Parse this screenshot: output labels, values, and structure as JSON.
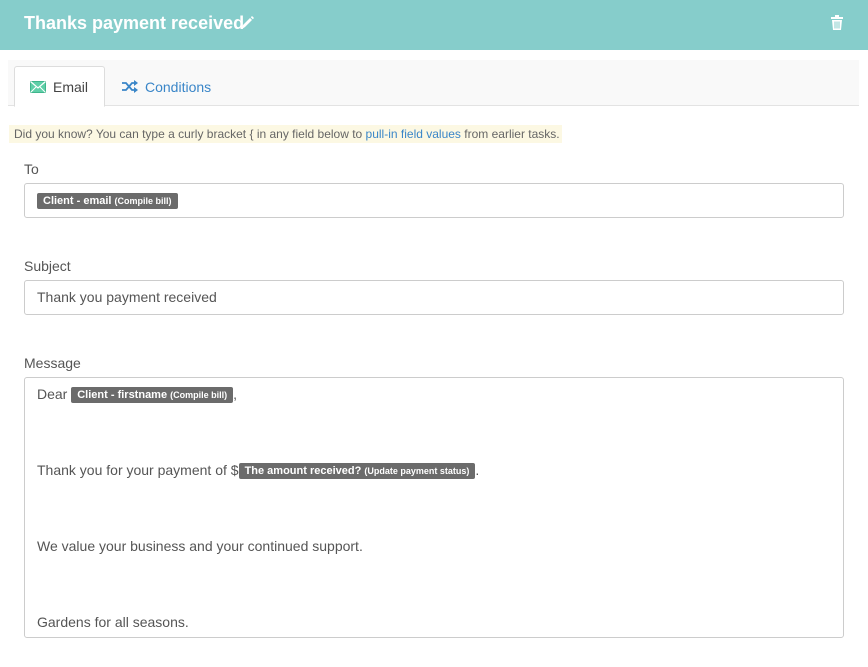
{
  "header": {
    "title": "Thanks payment received",
    "edit_icon": "pencil-icon",
    "delete_icon": "trash-icon",
    "background": "#86cdcb"
  },
  "tabs": [
    {
      "label": "Email",
      "icon": "envelope-icon",
      "active": true
    },
    {
      "label": "Conditions",
      "icon": "shuffle-icon",
      "active": false
    }
  ],
  "tip": {
    "prefix": "Did you know? You can type a curly bracket { in any field below to ",
    "link": "pull-in field values",
    "suffix": " from earlier tasks."
  },
  "fields": {
    "to": {
      "label": "To",
      "tokens": [
        {
          "name": "Client - email",
          "source": "(Compile bill)"
        }
      ]
    },
    "subject": {
      "label": "Subject",
      "value": "Thank you payment received"
    },
    "message": {
      "label": "Message",
      "line1": {
        "text": "Dear ",
        "token_name": "Client - firstname",
        "token_source": "(Compile bill)",
        "after": ","
      },
      "line2": {
        "text": "Thank you for your payment of $",
        "token_name": "The amount received?",
        "token_source": "(Update payment status)",
        "after": "."
      },
      "line3": {
        "text": "We value your business and your continued support."
      },
      "line4": {
        "text": "Gardens for all seasons."
      }
    }
  },
  "colors": {
    "link": "#3a86c8",
    "token_bg": "#6b6b6b",
    "tip_bg": "#fcf8e3"
  }
}
